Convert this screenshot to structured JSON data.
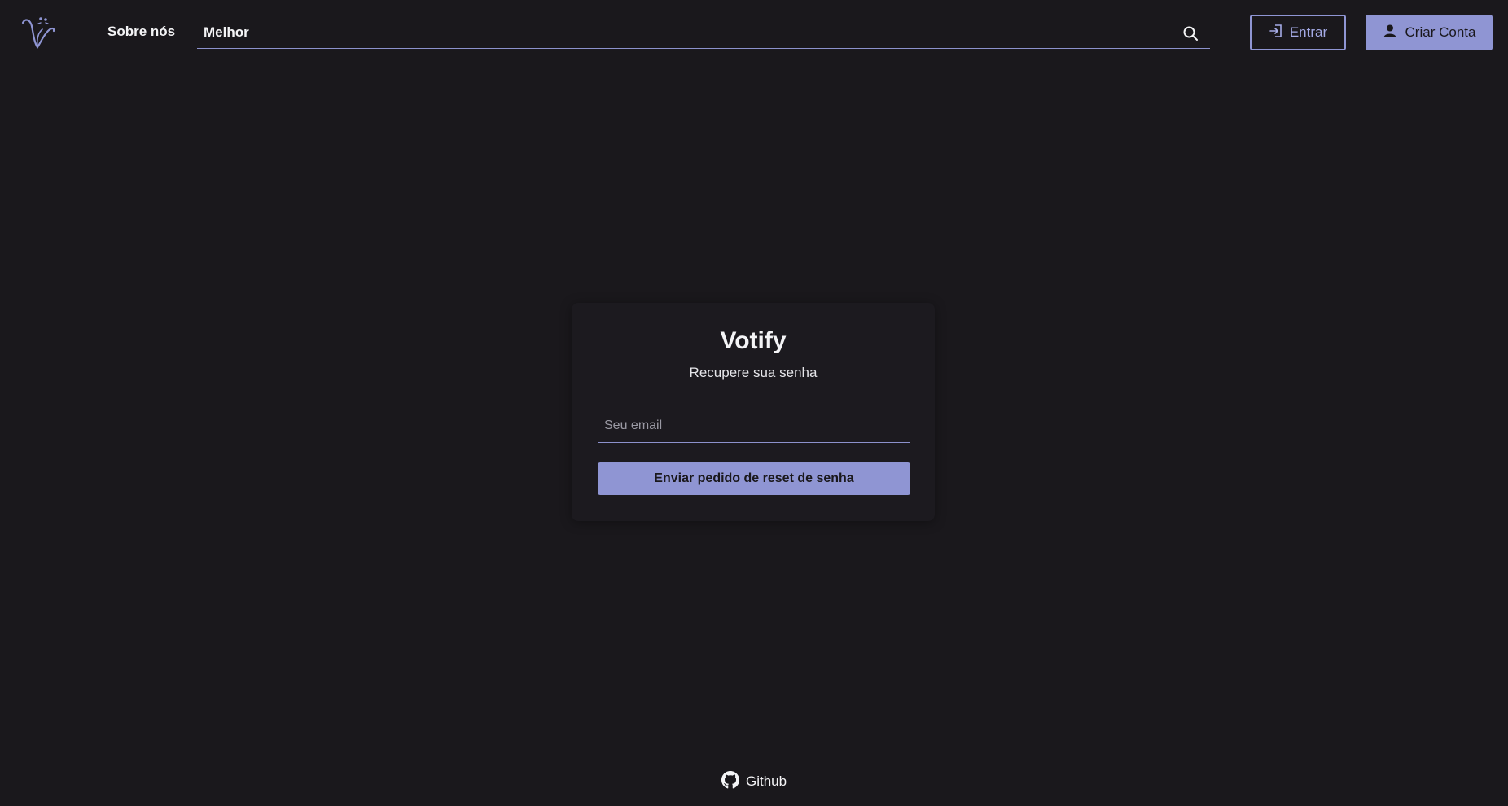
{
  "header": {
    "logo_icon": "votify-logo-icon",
    "nav_about": "Sobre nós",
    "search": {
      "value": "Melhor",
      "placeholder": "",
      "icon": "search-icon"
    },
    "login_button": {
      "label": "Entrar",
      "icon": "login-icon"
    },
    "signup_button": {
      "label": "Criar Conta",
      "icon": "user-icon"
    }
  },
  "card": {
    "title": "Votify",
    "subtitle": "Recupere sua senha",
    "email_placeholder": "Seu email",
    "submit_label": "Enviar pedido de reset de senha"
  },
  "footer": {
    "github_label": "Github",
    "github_icon": "github-icon"
  },
  "colors": {
    "background": "#1a181c",
    "accent": "#8f95d3",
    "text": "#f4f4f6"
  }
}
